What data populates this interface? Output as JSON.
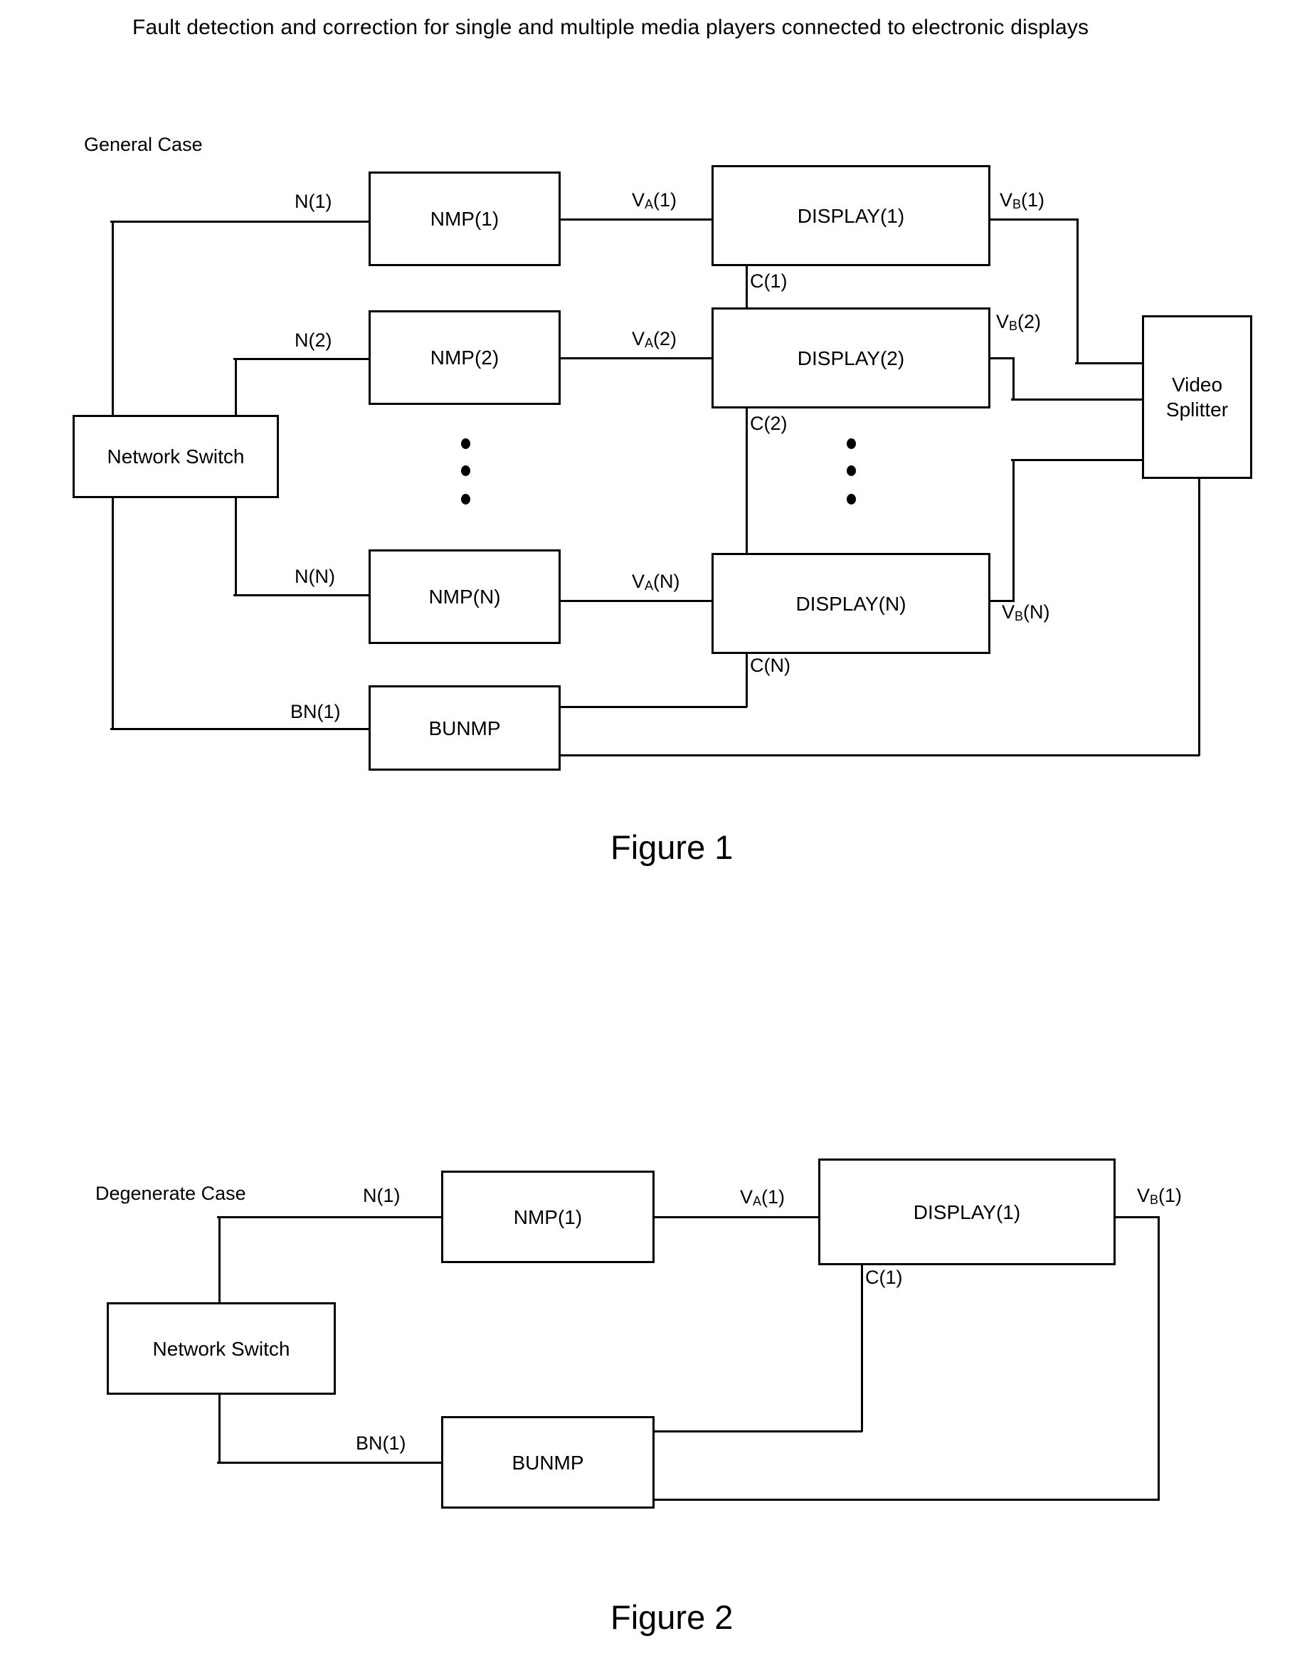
{
  "document": {
    "title": "Fault detection and correction for single and multiple media players connected to electronic displays"
  },
  "figure1": {
    "case_label": "General Case",
    "caption": "Figure 1",
    "blocks": {
      "network_switch": "Network Switch",
      "nmp1": "NMP(1)",
      "nmp2": "NMP(2)",
      "nmpN": "NMP(N)",
      "bunmp": "BUNMP",
      "display1": "DISPLAY(1)",
      "display2": "DISPLAY(2)",
      "displayN": "DISPLAY(N)",
      "video_splitter": "Video\nSplitter"
    },
    "edge_labels": {
      "n1": "N(1)",
      "n2": "N(2)",
      "nN": "N(N)",
      "bn1": "BN(1)",
      "va1_base": "V",
      "va1_sub": "A",
      "va1_idx": "(1)",
      "va2_base": "V",
      "va2_sub": "A",
      "va2_idx": "(2)",
      "vaN_base": "V",
      "vaN_sub": "A",
      "vaN_idx": "(N)",
      "vb1_base": "V",
      "vb1_sub": "B",
      "vb1_idx": "(1)",
      "vb2_base": "V",
      "vb2_sub": "B",
      "vb2_idx": "(2)",
      "vbN_base": "V",
      "vbN_sub": "B",
      "vbN_idx": "(N)",
      "c1": "C(1)",
      "c2": "C(2)",
      "cN": "C(N)"
    },
    "ellipsis_glyph": "vertical-ellipsis"
  },
  "figure2": {
    "case_label": "Degenerate Case",
    "caption": "Figure 2",
    "blocks": {
      "network_switch": "Network Switch",
      "nmp1": "NMP(1)",
      "bunmp": "BUNMP",
      "display1": "DISPLAY(1)"
    },
    "edge_labels": {
      "n1": "N(1)",
      "bn1": "BN(1)",
      "va1_base": "V",
      "va1_sub": "A",
      "va1_idx": "(1)",
      "vb1_base": "V",
      "vb1_sub": "B",
      "vb1_idx": "(1)",
      "c1": "C(1)"
    }
  },
  "colors": {
    "ink": "#000000",
    "paper": "#ffffff"
  }
}
